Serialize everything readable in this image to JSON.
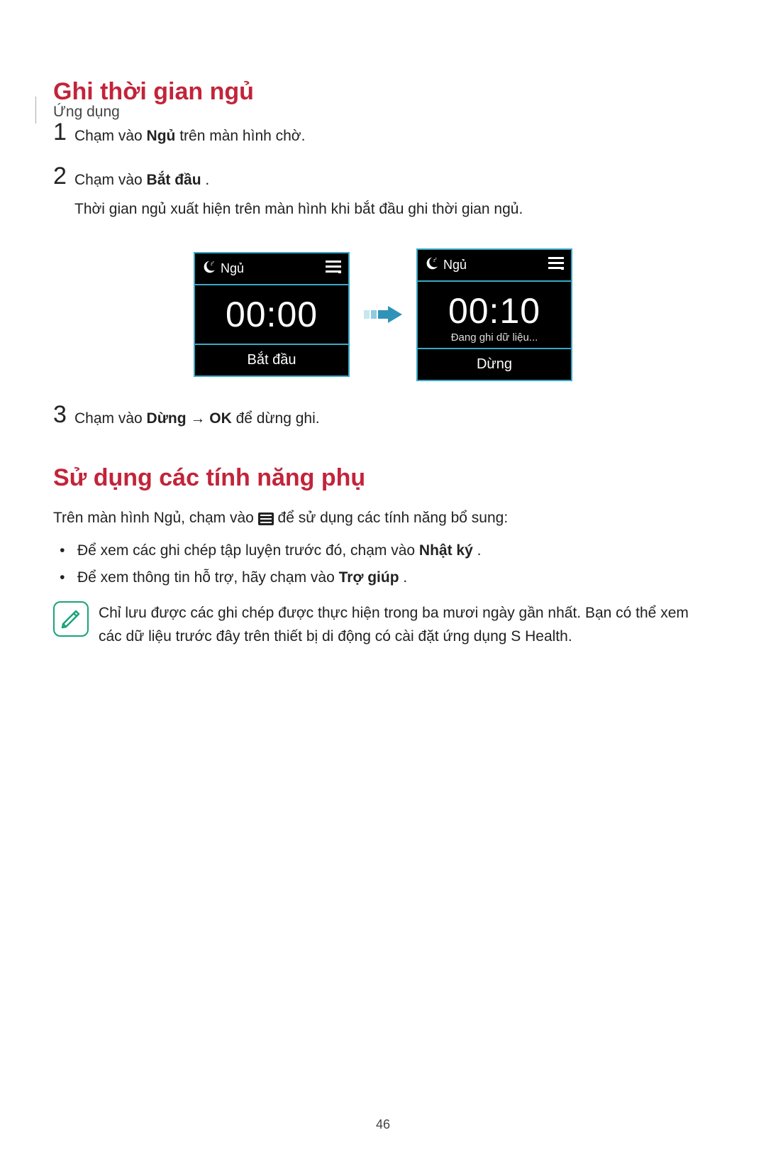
{
  "breadcrumb": "Ứng dụng",
  "section1_title": "Ghi thời gian ngủ",
  "steps": {
    "s1": {
      "num": "1",
      "pre": "Chạm vào ",
      "bold": "Ngủ",
      "post": " trên màn hình chờ."
    },
    "s2": {
      "num": "2",
      "pre": "Chạm vào ",
      "bold": "Bắt đầu",
      "post": ".",
      "line2": "Thời gian ngủ xuất hiện trên màn hình khi bắt đầu ghi thời gian ngủ."
    },
    "s3": {
      "num": "3",
      "pre": "Chạm vào ",
      "bold1": "Dừng",
      "arrow": " → ",
      "bold2": "OK",
      "post": " để dừng ghi."
    }
  },
  "phones": {
    "left": {
      "title": "Ngủ",
      "big": "00:00",
      "button": "Bắt đầu"
    },
    "right": {
      "title": "Ngủ",
      "big": "00:10",
      "sub": "Đang ghi dữ liệu...",
      "button": "Dừng"
    }
  },
  "section2_title": "Sử dụng các tính năng phụ",
  "section2_intro_pre": "Trên màn hình Ngủ, chạm vào ",
  "section2_intro_post": " để sử dụng các tính năng bổ sung:",
  "bullets": {
    "b1_pre": "Để xem các ghi chép tập luyện trước đó, chạm vào ",
    "b1_bold": "Nhật ký",
    "b1_post": ".",
    "b2_pre": "Để xem thông tin hỗ trợ, hãy chạm vào ",
    "b2_bold": "Trợ giúp",
    "b2_post": "."
  },
  "note": "Chỉ lưu được các ghi chép được thực hiện trong ba mươi ngày gần nhất. Bạn có thể xem các dữ liệu trước đây trên thiết bị di động có cài đặt ứng dụng S Health.",
  "page_number": "46"
}
